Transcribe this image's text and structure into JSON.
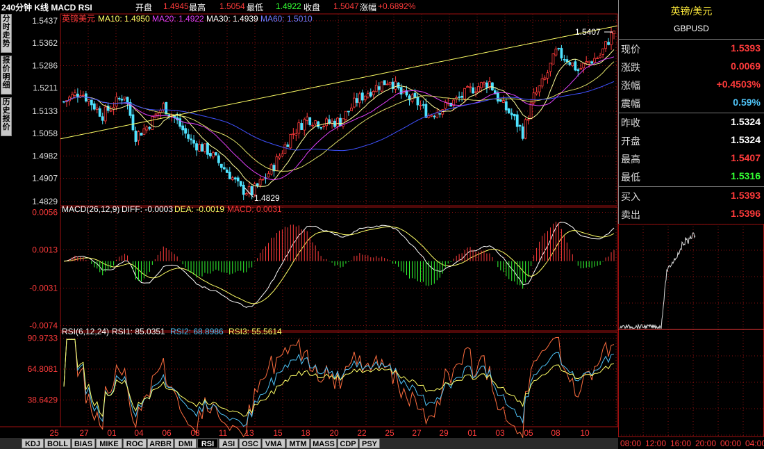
{
  "header": {
    "title": "240分钟 K线 MACD RSI",
    "open_label": "开盘",
    "open_value": "1.4945",
    "high_label": "最高",
    "high_value": "1.5054",
    "low_label": "最低",
    "low_value": "1.4922",
    "close_label": "收盘",
    "close_value": "1.5047",
    "change_label": "涨幅",
    "change_value": "+0.6892%"
  },
  "left_tabs": [
    "分时走势",
    "报价明细",
    "历史报价"
  ],
  "main": {
    "legend_name": "英镑美元",
    "ma10": "MA10: 1.4950",
    "ma20": "MA20: 1.4922",
    "ma30": "MA30: 1.4939",
    "ma60": "MA60: 1.5010",
    "y_ticks": [
      "1.5437",
      "1.5362",
      "1.5286",
      "1.5211",
      "1.5133",
      "1.5058",
      "1.4982",
      "1.4907",
      "1.4829"
    ],
    "max_label": "1.5407",
    "min_label": "1.4829"
  },
  "macd": {
    "title": "MACD(26,12,9)",
    "diff": "DIFF: -0.0003",
    "dea": "DEA: -0.0019",
    "macd": "MACD: 0.0031",
    "y_ticks": [
      "0.0056",
      "0.0013",
      "-0.0031",
      "-0.0074"
    ]
  },
  "rsi": {
    "title": "RSI(6,12,24)",
    "rsi1": "RSI1: 85.0351",
    "rsi2": "RSI2: 68.8986",
    "rsi3": "RSI3: 55.5614",
    "y_ticks": [
      "90.9733",
      "64.8081",
      "38.6429"
    ]
  },
  "x_axis": [
    "25",
    "27",
    "01",
    "04",
    "06",
    "08",
    "11",
    "13",
    "15",
    "18",
    "20",
    "22",
    "25",
    "27",
    "29",
    "01",
    "03",
    "05",
    "08",
    "10"
  ],
  "bottom_tabs": [
    "KDJ",
    "BOLL",
    "BIAS",
    "MIKE",
    "ROC",
    "ARBR",
    "DMI",
    "RSI",
    "ASI",
    "OSC",
    "VMA",
    "MTM",
    "MASS",
    "CDP",
    "PSY"
  ],
  "active_tab": "RSI",
  "quote": {
    "name": "英镑/美元",
    "code": "GBPUSD",
    "rows": [
      {
        "label": "现价",
        "value": "1.5393",
        "color": "#ff3b3b"
      },
      {
        "label": "涨跌",
        "value": "0.0069",
        "color": "#ff3b3b"
      },
      {
        "label": "涨幅",
        "value": "+0.4503%",
        "color": "#ff3b3b"
      },
      {
        "label": "震幅",
        "value": "0.59%",
        "color": "#4fc3f7"
      },
      {
        "label": "昨收",
        "value": "1.5324",
        "color": "#ffffff"
      },
      {
        "label": "开盘",
        "value": "1.5324",
        "color": "#ffffff"
      },
      {
        "label": "最高",
        "value": "1.5407",
        "color": "#ff3b3b"
      },
      {
        "label": "最低",
        "value": "1.5316",
        "color": "#33ff33"
      },
      {
        "label": "买入",
        "value": "1.5393",
        "color": "#ff3b3b"
      },
      {
        "label": "卖出",
        "value": "1.5396",
        "color": "#ff3b3b"
      }
    ]
  },
  "mini_x_axis": [
    "08:00",
    "12:00",
    "16:00",
    "20:00",
    "00:00",
    "04:00"
  ],
  "colors": {
    "up": "#ff3b3b",
    "down": "#4fe3ff",
    "grid": "#8a1010",
    "ma10": "#ffff66",
    "ma20": "#e040fb",
    "ma30": "#ffff99",
    "ma60": "#3f51ff"
  }
}
